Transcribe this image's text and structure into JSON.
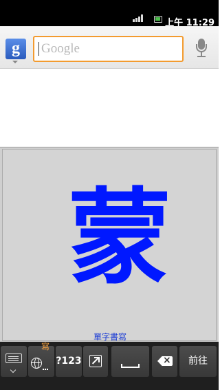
{
  "status_bar": {
    "time": "上午 11:29",
    "icons": [
      "signal-icon",
      "battery-icon"
    ]
  },
  "search": {
    "logo": "g",
    "placeholder": "Google",
    "value": ""
  },
  "handwriting": {
    "written_character": "蒙",
    "mode_label": "單字書寫",
    "ink_color": "#0018ff"
  },
  "keyboard": {
    "keys": {
      "keyboard_switch": "keyboard-icon",
      "language": {
        "icon": "globe-icon",
        "char": "寫"
      },
      "symbols": "?123",
      "arrow": "expand-arrow-icon",
      "space": "space-icon",
      "backspace": "backspace-icon",
      "go": "前往"
    }
  },
  "colors": {
    "accent": "#f39b2f",
    "ink": "#0018ff",
    "lang_char": "#f3a040"
  }
}
